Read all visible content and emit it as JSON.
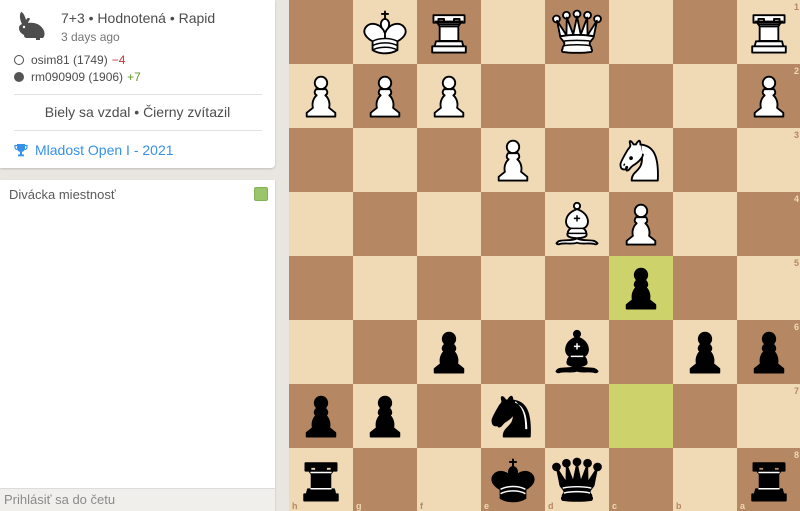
{
  "game": {
    "variant_icon": "rabbit-icon",
    "title": "7+3 • Hodnotená • Rapid",
    "date": "3 days ago",
    "players": [
      {
        "name": "osim81 (1749)",
        "diff": "−4",
        "color": "white"
      },
      {
        "name": "rm090909 (1906)",
        "diff": "+7",
        "color": "black"
      }
    ],
    "result": "Biely sa vzdal • Čierny zvítazil",
    "tournament": "Mladost Open I - 2021",
    "tournament_icon": "trophy-icon"
  },
  "chat": {
    "title": "Divácka miestnosť",
    "toggle_enabled": true,
    "input_label": "Prihlásiť sa do četu"
  },
  "board": {
    "orientation": "black",
    "files": [
      "h",
      "g",
      "f",
      "e",
      "d",
      "c",
      "b",
      "a"
    ],
    "ranks": [
      "1",
      "2",
      "3",
      "4",
      "5",
      "6",
      "7",
      "8"
    ],
    "light_color": "#f0d9b5",
    "dark_color": "#b58863",
    "last_move": [
      "c7",
      "c5"
    ],
    "pieces": [
      {
        "square": "g1",
        "type": "king",
        "color": "white"
      },
      {
        "square": "f1",
        "type": "rook",
        "color": "white"
      },
      {
        "square": "d1",
        "type": "queen",
        "color": "white"
      },
      {
        "square": "a1",
        "type": "rook",
        "color": "white"
      },
      {
        "square": "h2",
        "type": "pawn",
        "color": "white"
      },
      {
        "square": "g2",
        "type": "pawn",
        "color": "white"
      },
      {
        "square": "f2",
        "type": "pawn",
        "color": "white"
      },
      {
        "square": "a2",
        "type": "pawn",
        "color": "white"
      },
      {
        "square": "e3",
        "type": "pawn",
        "color": "white"
      },
      {
        "square": "c3",
        "type": "knight",
        "color": "white"
      },
      {
        "square": "d4",
        "type": "bishop",
        "color": "white"
      },
      {
        "square": "c4",
        "type": "pawn",
        "color": "white"
      },
      {
        "square": "c5",
        "type": "pawn",
        "color": "black"
      },
      {
        "square": "f6",
        "type": "pawn",
        "color": "black"
      },
      {
        "square": "d6",
        "type": "bishop",
        "color": "black"
      },
      {
        "square": "b6",
        "type": "pawn",
        "color": "black"
      },
      {
        "square": "a6",
        "type": "pawn",
        "color": "black"
      },
      {
        "square": "h7",
        "type": "pawn",
        "color": "black"
      },
      {
        "square": "g7",
        "type": "pawn",
        "color": "black"
      },
      {
        "square": "e7",
        "type": "knight",
        "color": "black"
      },
      {
        "square": "h8",
        "type": "rook",
        "color": "black"
      },
      {
        "square": "e8",
        "type": "king",
        "color": "black"
      },
      {
        "square": "d8",
        "type": "queen",
        "color": "black"
      },
      {
        "square": "a8",
        "type": "rook",
        "color": "black"
      }
    ]
  }
}
